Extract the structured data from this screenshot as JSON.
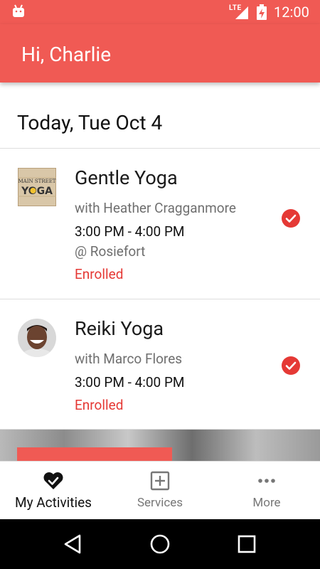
{
  "status_bar": {
    "network": "LTE",
    "time": "12:00",
    "icons": [
      "android-icon",
      "signal-icon",
      "battery-charging-icon"
    ]
  },
  "app_bar": {
    "title": "Hi, Charlie"
  },
  "date_header": "Today, Tue Oct 4",
  "activities": [
    {
      "name": "Gentle Yoga",
      "instructor": "with Heather Cragganmore",
      "time": "3:00 PM - 4:00 PM",
      "location": "@ Rosiefort",
      "status": "Enrolled",
      "thumb_logo": {
        "line1": "MAIN STREET",
        "line2": "YOGA"
      },
      "icon": "check-circle-icon"
    },
    {
      "name": "Reiki Yoga",
      "instructor": "with Marco Flores",
      "time": "3:00 PM - 4:00 PM",
      "status": "Enrolled",
      "icon": "check-circle-icon"
    }
  ],
  "bottom_nav": {
    "items": [
      {
        "label": "My Activities",
        "icon": "heart-check-icon",
        "active": true
      },
      {
        "label": "Services",
        "icon": "plus-square-icon",
        "active": false
      },
      {
        "label": "More",
        "icon": "more-horizontal-icon",
        "active": false
      }
    ]
  },
  "system_nav": {
    "icons": [
      "back-icon",
      "home-icon",
      "recents-icon"
    ]
  },
  "colors": {
    "primary": "#f05a54",
    "accent_red": "#e53935",
    "text_primary": "#212121",
    "text_secondary": "#6f6f6f"
  }
}
